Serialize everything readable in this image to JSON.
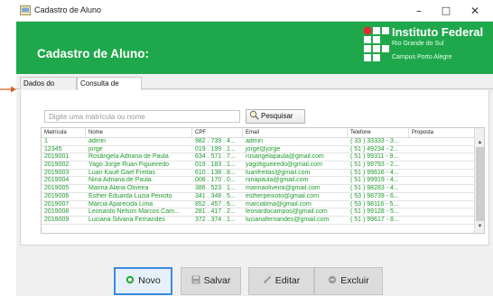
{
  "window": {
    "title": "Cadastro de Aluno",
    "minimize": "–",
    "maximize": "□",
    "close": "✕"
  },
  "banner": {
    "title": "Cadastro de Aluno:",
    "institution": "Instituto Federal",
    "subtitle1": "Rio Grande do Sul",
    "subtitle2": "Campus Porto Alegre",
    "color": "#1fa84b"
  },
  "tabs": [
    {
      "label": "Dados do aluno"
    },
    {
      "label": "Consulta de alunos"
    }
  ],
  "search": {
    "placeholder": "Digite uma matrícula ou nome",
    "button_label": "Pesquisar"
  },
  "table": {
    "columns": [
      "Matrícula",
      "Nome",
      "CPF",
      "Email",
      "Telefone",
      "Proposta"
    ],
    "rows": [
      {
        "matricula": "1",
        "nome": "admin",
        "cpf": "982 . 739 . 4...",
        "email": "admin",
        "telefone": "( 33 ) 33333 - 3...",
        "proposta": ""
      },
      {
        "matricula": "12345",
        "nome": "jorge",
        "cpf": "019 . 199 . 1...",
        "email": "jorge@jorge",
        "telefone": "( 51 ) 49234 - 2...",
        "proposta": ""
      },
      {
        "matricula": "2019001",
        "nome": "Rosângela Adriana de Paula",
        "cpf": "634 . 571 . 7...",
        "email": "rosangelapaula@gmail.com",
        "telefone": "( 51 ) 99311 - 9...",
        "proposta": ""
      },
      {
        "matricula": "2019002",
        "nome": "Yago Jorge Ruan Figueiredo",
        "cpf": "019 . 183 . 1...",
        "email": "yagofigueiredo@gmail.com",
        "telefone": "( 51 ) 99793 - 2...",
        "proposta": ""
      },
      {
        "matricula": "2019003",
        "nome": "Luan Kauê Gael Freitas",
        "cpf": "610 . 138 . 8...",
        "email": "luanfreitas@gmail.com",
        "telefone": "( 51 ) 99616 - 4...",
        "proposta": ""
      },
      {
        "matricula": "2019004",
        "nome": "Nina Adriana de Paula",
        "cpf": "008 . 170 . 0...",
        "email": "ninapaula@gmail.com",
        "telefone": "( 51 ) 99919 - 4...",
        "proposta": ""
      },
      {
        "matricula": "2019005",
        "nome": "Marina Alana Oliveira",
        "cpf": "386 . 523 . 1...",
        "email": "marinaoliveira@gmail.com",
        "telefone": "( 51 ) 98283 - 4...",
        "proposta": ""
      },
      {
        "matricula": "2019006",
        "nome": "Esther Eduarda Luzia Peixoto",
        "cpf": "341 . 348 . 5...",
        "email": "estherpeixoto@gmail.com",
        "telefone": "( 53 ) 98739 - 6...",
        "proposta": ""
      },
      {
        "matricula": "2019007",
        "nome": "Márcia Aparecida Lima",
        "cpf": "852 . 457 . 6...",
        "email": "marcialima@gmail.com",
        "telefone": "( 53 ) 98116 - 5...",
        "proposta": ""
      },
      {
        "matricula": "2019008",
        "nome": "Leonardo Nelson Marcos Cam...",
        "cpf": "281 . 417 . 2...",
        "email": "leonardocampos@gmail.com",
        "telefone": "( 51 ) 99128 - 5...",
        "proposta": ""
      },
      {
        "matricula": "2019009",
        "nome": "Luciana Silvana Fernandes",
        "cpf": "372 . 374 . 1...",
        "email": "lucianafernandes@gmail.com",
        "telefone": "( 51 ) 99617 - 8...",
        "proposta": ""
      }
    ],
    "text_color": "#1f9a2e"
  },
  "actions": {
    "novo": "Novo",
    "salvar": "Salvar",
    "editar": "Editar",
    "excluir": "Excluir"
  }
}
